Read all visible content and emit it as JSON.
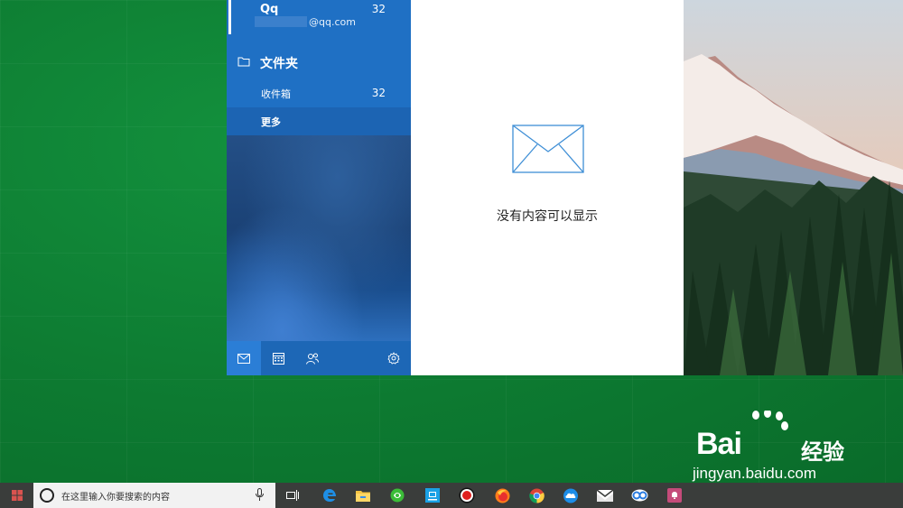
{
  "mail": {
    "account": {
      "name": "Qq",
      "count": "32",
      "email": "@qq.com"
    },
    "folders_title": "文件夹",
    "inbox": {
      "label": "收件箱",
      "count": "32"
    },
    "more_label": "更多",
    "empty_message": "没有内容可以显示"
  },
  "taskbar": {
    "search_placeholder": "在这里输入你要搜索的内容",
    "apps": [
      "task-view",
      "edge",
      "file-explorer",
      "green-app",
      "store",
      "recorder",
      "firefox",
      "chrome",
      "cloud-drive",
      "mail",
      "baidu-netdisk",
      "notification-app"
    ]
  },
  "watermark": {
    "brand": "Bai",
    "brand_suffix": "经验",
    "url": "jingyan.baidu.com"
  },
  "colors": {
    "desktop": "#0f7a32",
    "nav_pane": "#1e6cbf",
    "taskbar": "#3a3d3b",
    "content": "#ffffff"
  }
}
